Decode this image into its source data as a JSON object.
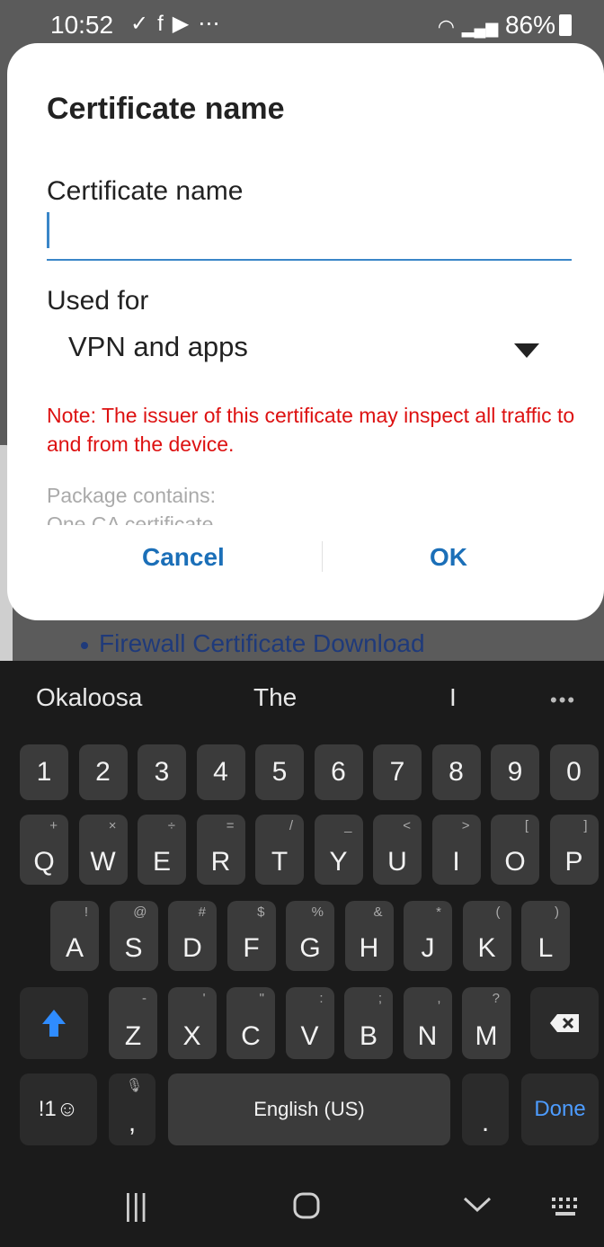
{
  "status_bar": {
    "time": "10:52",
    "left_icons": [
      "download-done-icon",
      "facebook-icon",
      "youtube-icon",
      "more-dots-icon"
    ],
    "battery": "86%"
  },
  "background": {
    "link_text": "Firewall Certificate Download"
  },
  "dialog": {
    "title": "Certificate name",
    "name_label": "Certificate name",
    "name_value": "",
    "used_for_label": "Used for",
    "used_for_value": "VPN and apps",
    "note": "Note: The issuer of this certificate may inspect all traffic to and from the device.",
    "package_label": "Package contains:",
    "package_value": "One CA certificate",
    "cancel": "Cancel",
    "ok": "OK"
  },
  "keyboard": {
    "suggestions": [
      "Okaloosa",
      "The",
      "I"
    ],
    "more": "•••",
    "number_row": [
      "1",
      "2",
      "3",
      "4",
      "5",
      "6",
      "7",
      "8",
      "9",
      "0"
    ],
    "row1": [
      [
        "Q",
        "+"
      ],
      [
        "W",
        "×"
      ],
      [
        "E",
        "÷"
      ],
      [
        "R",
        "="
      ],
      [
        "T",
        "/"
      ],
      [
        "Y",
        "_"
      ],
      [
        "U",
        "<"
      ],
      [
        "I",
        ">"
      ],
      [
        "O",
        "["
      ],
      [
        "P",
        "]"
      ]
    ],
    "row2": [
      [
        "A",
        "!"
      ],
      [
        "S",
        "@"
      ],
      [
        "D",
        "#"
      ],
      [
        "F",
        "$"
      ],
      [
        "G",
        "%"
      ],
      [
        "H",
        "&"
      ],
      [
        "J",
        "*"
      ],
      [
        "K",
        "("
      ],
      [
        "L",
        ")"
      ]
    ],
    "row3": [
      [
        "Z",
        "-"
      ],
      [
        "X",
        "'"
      ],
      [
        "C",
        "\""
      ],
      [
        "V",
        ":"
      ],
      [
        "B",
        ";"
      ],
      [
        "N",
        ","
      ],
      [
        "M",
        "?"
      ]
    ],
    "symbols_key": "!1☺",
    "comma_key": ",",
    "space_label": "English (US)",
    "period_key": ".",
    "done_label": "Done",
    "accent_color": "#2f8cff"
  },
  "nav_bar": {
    "recents_icon": "recents-icon",
    "home_icon": "home-icon",
    "hide_keyboard_icon": "hide-keyboard-icon",
    "keyboard_switch_icon": "keyboard-switch-icon"
  }
}
